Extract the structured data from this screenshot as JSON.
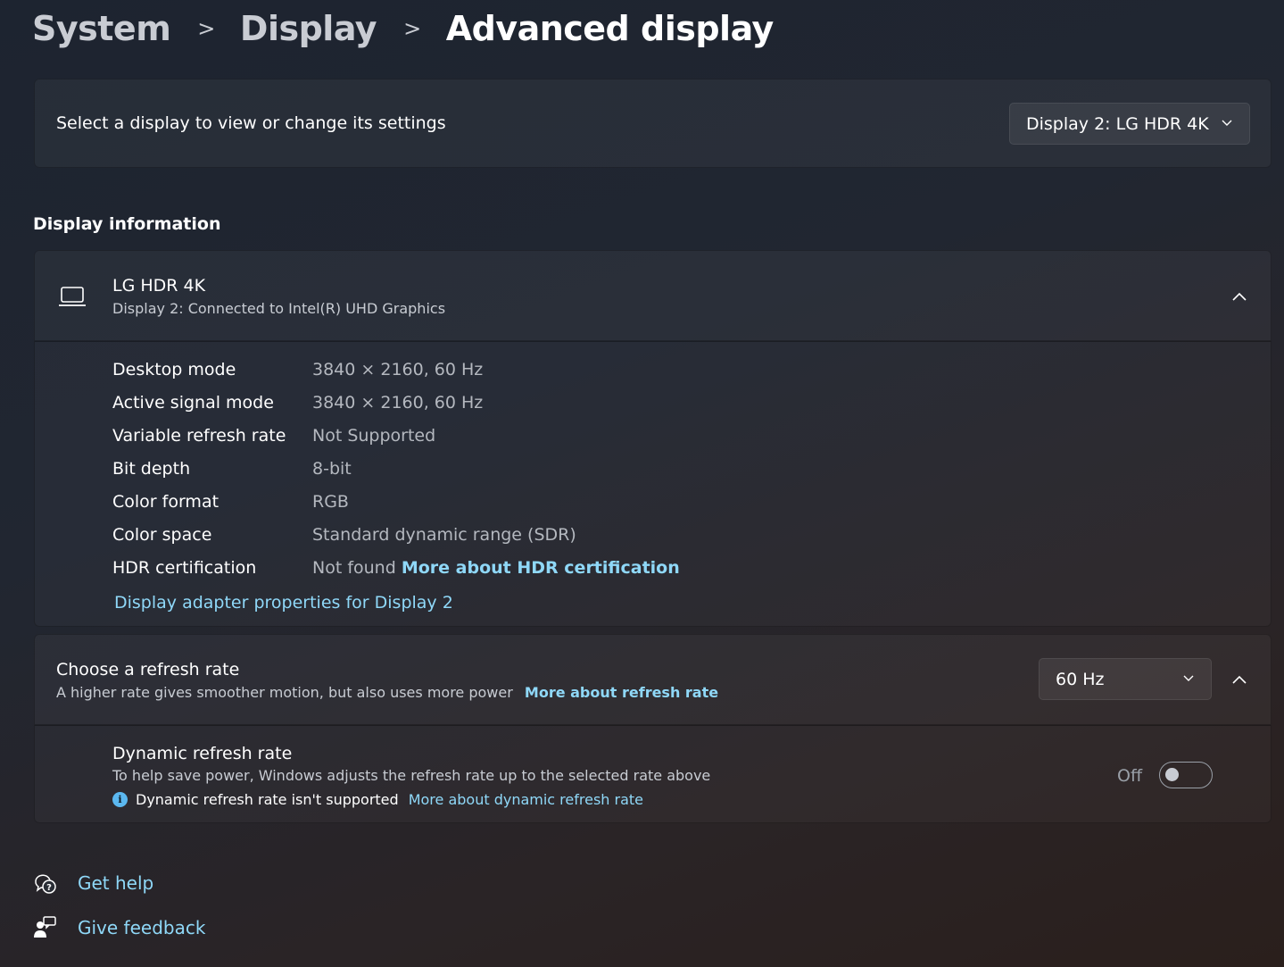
{
  "breadcrumb": {
    "items": [
      "System",
      "Display",
      "Advanced display"
    ],
    "separator": ">"
  },
  "select_display": {
    "label": "Select a display to view or change its settings",
    "selected": "Display 2: LG HDR 4K"
  },
  "display_information": {
    "section_title": "Display information",
    "monitor_name": "LG HDR 4K",
    "monitor_subtitle": "Display 2: Connected to Intel(R) UHD Graphics",
    "rows": [
      {
        "label": "Desktop mode",
        "value": "3840 × 2160, 60 Hz"
      },
      {
        "label": "Active signal mode",
        "value": "3840 × 2160, 60 Hz"
      },
      {
        "label": "Variable refresh rate",
        "value": "Not Supported"
      },
      {
        "label": "Bit depth",
        "value": "8-bit"
      },
      {
        "label": "Color format",
        "value": "RGB"
      },
      {
        "label": "Color space",
        "value": "Standard dynamic range (SDR)"
      },
      {
        "label": "HDR certification",
        "value": "Not found",
        "link": "More about HDR certification"
      }
    ],
    "adapter_link": "Display adapter properties for Display 2"
  },
  "refresh_rate": {
    "title": "Choose a refresh rate",
    "subtitle": "A higher rate gives smoother motion, but also uses more power",
    "link": "More about refresh rate",
    "selected": "60 Hz"
  },
  "dynamic_refresh": {
    "title": "Dynamic refresh rate",
    "subtitle": "To help save power, Windows adjusts the refresh rate up to the selected rate above",
    "note": "Dynamic refresh rate isn't supported",
    "note_link": "More about dynamic refresh rate",
    "toggle_label": "Off",
    "toggle_on": false
  },
  "footer": {
    "get_help": "Get help",
    "give_feedback": "Give feedback"
  },
  "colors": {
    "accent_link": "#8fd8f8",
    "info_icon": "#5bb8f0"
  },
  "icons": {
    "monitor": "laptop-monitor-icon",
    "chevron_down": "chevron-down-icon",
    "chevron_up": "chevron-up-icon",
    "info": "info-icon",
    "help": "help-icon",
    "feedback": "feedback-icon"
  }
}
